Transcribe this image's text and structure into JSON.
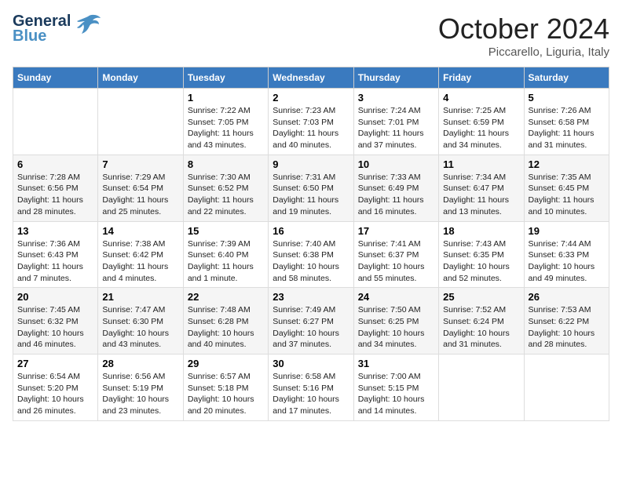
{
  "header": {
    "logo_line1": "General",
    "logo_line2": "Blue",
    "month": "October 2024",
    "location": "Piccarello, Liguria, Italy"
  },
  "weekdays": [
    "Sunday",
    "Monday",
    "Tuesday",
    "Wednesday",
    "Thursday",
    "Friday",
    "Saturday"
  ],
  "weeks": [
    [
      {
        "day": "",
        "sunrise": "",
        "sunset": "",
        "daylight": ""
      },
      {
        "day": "",
        "sunrise": "",
        "sunset": "",
        "daylight": ""
      },
      {
        "day": "1",
        "sunrise": "Sunrise: 7:22 AM",
        "sunset": "Sunset: 7:05 PM",
        "daylight": "Daylight: 11 hours and 43 minutes."
      },
      {
        "day": "2",
        "sunrise": "Sunrise: 7:23 AM",
        "sunset": "Sunset: 7:03 PM",
        "daylight": "Daylight: 11 hours and 40 minutes."
      },
      {
        "day": "3",
        "sunrise": "Sunrise: 7:24 AM",
        "sunset": "Sunset: 7:01 PM",
        "daylight": "Daylight: 11 hours and 37 minutes."
      },
      {
        "day": "4",
        "sunrise": "Sunrise: 7:25 AM",
        "sunset": "Sunset: 6:59 PM",
        "daylight": "Daylight: 11 hours and 34 minutes."
      },
      {
        "day": "5",
        "sunrise": "Sunrise: 7:26 AM",
        "sunset": "Sunset: 6:58 PM",
        "daylight": "Daylight: 11 hours and 31 minutes."
      }
    ],
    [
      {
        "day": "6",
        "sunrise": "Sunrise: 7:28 AM",
        "sunset": "Sunset: 6:56 PM",
        "daylight": "Daylight: 11 hours and 28 minutes."
      },
      {
        "day": "7",
        "sunrise": "Sunrise: 7:29 AM",
        "sunset": "Sunset: 6:54 PM",
        "daylight": "Daylight: 11 hours and 25 minutes."
      },
      {
        "day": "8",
        "sunrise": "Sunrise: 7:30 AM",
        "sunset": "Sunset: 6:52 PM",
        "daylight": "Daylight: 11 hours and 22 minutes."
      },
      {
        "day": "9",
        "sunrise": "Sunrise: 7:31 AM",
        "sunset": "Sunset: 6:50 PM",
        "daylight": "Daylight: 11 hours and 19 minutes."
      },
      {
        "day": "10",
        "sunrise": "Sunrise: 7:33 AM",
        "sunset": "Sunset: 6:49 PM",
        "daylight": "Daylight: 11 hours and 16 minutes."
      },
      {
        "day": "11",
        "sunrise": "Sunrise: 7:34 AM",
        "sunset": "Sunset: 6:47 PM",
        "daylight": "Daylight: 11 hours and 13 minutes."
      },
      {
        "day": "12",
        "sunrise": "Sunrise: 7:35 AM",
        "sunset": "Sunset: 6:45 PM",
        "daylight": "Daylight: 11 hours and 10 minutes."
      }
    ],
    [
      {
        "day": "13",
        "sunrise": "Sunrise: 7:36 AM",
        "sunset": "Sunset: 6:43 PM",
        "daylight": "Daylight: 11 hours and 7 minutes."
      },
      {
        "day": "14",
        "sunrise": "Sunrise: 7:38 AM",
        "sunset": "Sunset: 6:42 PM",
        "daylight": "Daylight: 11 hours and 4 minutes."
      },
      {
        "day": "15",
        "sunrise": "Sunrise: 7:39 AM",
        "sunset": "Sunset: 6:40 PM",
        "daylight": "Daylight: 11 hours and 1 minute."
      },
      {
        "day": "16",
        "sunrise": "Sunrise: 7:40 AM",
        "sunset": "Sunset: 6:38 PM",
        "daylight": "Daylight: 10 hours and 58 minutes."
      },
      {
        "day": "17",
        "sunrise": "Sunrise: 7:41 AM",
        "sunset": "Sunset: 6:37 PM",
        "daylight": "Daylight: 10 hours and 55 minutes."
      },
      {
        "day": "18",
        "sunrise": "Sunrise: 7:43 AM",
        "sunset": "Sunset: 6:35 PM",
        "daylight": "Daylight: 10 hours and 52 minutes."
      },
      {
        "day": "19",
        "sunrise": "Sunrise: 7:44 AM",
        "sunset": "Sunset: 6:33 PM",
        "daylight": "Daylight: 10 hours and 49 minutes."
      }
    ],
    [
      {
        "day": "20",
        "sunrise": "Sunrise: 7:45 AM",
        "sunset": "Sunset: 6:32 PM",
        "daylight": "Daylight: 10 hours and 46 minutes."
      },
      {
        "day": "21",
        "sunrise": "Sunrise: 7:47 AM",
        "sunset": "Sunset: 6:30 PM",
        "daylight": "Daylight: 10 hours and 43 minutes."
      },
      {
        "day": "22",
        "sunrise": "Sunrise: 7:48 AM",
        "sunset": "Sunset: 6:28 PM",
        "daylight": "Daylight: 10 hours and 40 minutes."
      },
      {
        "day": "23",
        "sunrise": "Sunrise: 7:49 AM",
        "sunset": "Sunset: 6:27 PM",
        "daylight": "Daylight: 10 hours and 37 minutes."
      },
      {
        "day": "24",
        "sunrise": "Sunrise: 7:50 AM",
        "sunset": "Sunset: 6:25 PM",
        "daylight": "Daylight: 10 hours and 34 minutes."
      },
      {
        "day": "25",
        "sunrise": "Sunrise: 7:52 AM",
        "sunset": "Sunset: 6:24 PM",
        "daylight": "Daylight: 10 hours and 31 minutes."
      },
      {
        "day": "26",
        "sunrise": "Sunrise: 7:53 AM",
        "sunset": "Sunset: 6:22 PM",
        "daylight": "Daylight: 10 hours and 28 minutes."
      }
    ],
    [
      {
        "day": "27",
        "sunrise": "Sunrise: 6:54 AM",
        "sunset": "Sunset: 5:20 PM",
        "daylight": "Daylight: 10 hours and 26 minutes."
      },
      {
        "day": "28",
        "sunrise": "Sunrise: 6:56 AM",
        "sunset": "Sunset: 5:19 PM",
        "daylight": "Daylight: 10 hours and 23 minutes."
      },
      {
        "day": "29",
        "sunrise": "Sunrise: 6:57 AM",
        "sunset": "Sunset: 5:18 PM",
        "daylight": "Daylight: 10 hours and 20 minutes."
      },
      {
        "day": "30",
        "sunrise": "Sunrise: 6:58 AM",
        "sunset": "Sunset: 5:16 PM",
        "daylight": "Daylight: 10 hours and 17 minutes."
      },
      {
        "day": "31",
        "sunrise": "Sunrise: 7:00 AM",
        "sunset": "Sunset: 5:15 PM",
        "daylight": "Daylight: 10 hours and 14 minutes."
      },
      {
        "day": "",
        "sunrise": "",
        "sunset": "",
        "daylight": ""
      },
      {
        "day": "",
        "sunrise": "",
        "sunset": "",
        "daylight": ""
      }
    ]
  ]
}
